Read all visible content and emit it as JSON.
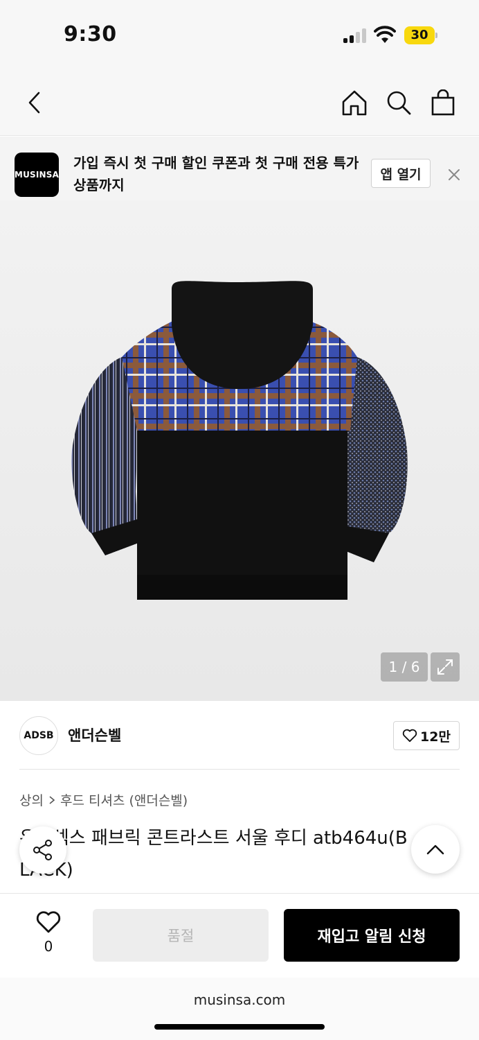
{
  "status_bar": {
    "time": "9:30",
    "battery": "30"
  },
  "nav": {
    "back_icon": "chevron-left-icon",
    "home_icon": "home-icon",
    "search_icon": "search-icon",
    "cart_icon": "shopping-bag-icon"
  },
  "app_banner": {
    "logo_text": "MUSINSA",
    "message": "가입 즉시 첫 구매 할인 쿠폰과 첫 구매 전용 특가 상품까지",
    "open_button": "앱 열기",
    "close_icon": "close-icon"
  },
  "gallery": {
    "counter": "1 / 6",
    "expand_icon": "expand-icon"
  },
  "brand": {
    "logo_text": "ADSB",
    "name": "앤더슨벨",
    "likes": "12만"
  },
  "breadcrumb": {
    "category": "상의",
    "subcategory": "후드 티셔츠 (앤더슨벨)"
  },
  "product": {
    "title_line1": "유니섹스 패브릭 콘트라스트 서울 후디 atb464u(B",
    "title_line2": "LACK)"
  },
  "action_bar": {
    "wish_count": "0",
    "soldout_label": "품절",
    "restock_label": "재입고 알림 신청"
  },
  "browser": {
    "url": "musinsa.com"
  },
  "colors": {
    "accent": "#000000",
    "banner_bg": "#f4f4f4",
    "battery": "#f8d80e"
  }
}
